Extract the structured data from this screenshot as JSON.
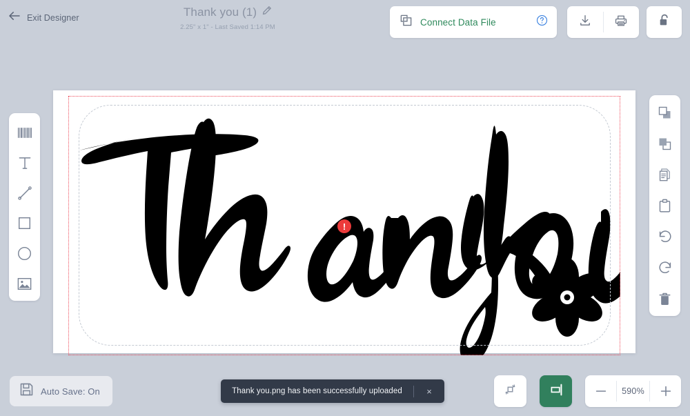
{
  "header": {
    "exit_label": "Exit Designer",
    "exit_icon": "arrow-left-icon",
    "doc_title": "Thank you (1)",
    "doc_title_edit_icon": "pencil-icon",
    "doc_subtitle": "2.25\" x 1\" - Last Saved 1:14 PM",
    "connect_data_file": {
      "label": "Connect Data File",
      "icon": "connect-link-icon",
      "help_icon": "question-circle-icon",
      "text_color": "#2f8a5c",
      "help_color": "#3b82e0"
    },
    "io_buttons": [
      {
        "name": "download-button",
        "icon": "download-icon"
      },
      {
        "name": "print-button",
        "icon": "printer-icon"
      }
    ],
    "lock_button": {
      "name": "lock-button",
      "icon": "unlock-icon",
      "state": "unlocked"
    }
  },
  "left_toolbar": {
    "items": [
      {
        "name": "tool-barcode",
        "icon": "barcode-icon"
      },
      {
        "name": "tool-text",
        "icon": "text-t-icon"
      },
      {
        "name": "tool-line",
        "icon": "line-icon"
      },
      {
        "name": "tool-rectangle",
        "icon": "rectangle-icon"
      },
      {
        "name": "tool-ellipse",
        "icon": "circle-icon"
      },
      {
        "name": "tool-image",
        "icon": "image-icon"
      }
    ]
  },
  "right_toolbar": {
    "items": [
      {
        "name": "bring-to-front-button",
        "icon": "bring-to-front-icon"
      },
      {
        "name": "send-to-back-button",
        "icon": "send-to-back-icon"
      },
      {
        "name": "copy-button",
        "icon": "copy-icon"
      },
      {
        "name": "paste-button",
        "icon": "clipboard-icon"
      },
      {
        "name": "undo-button",
        "icon": "undo-icon"
      },
      {
        "name": "redo-button",
        "icon": "redo-icon"
      },
      {
        "name": "delete-button",
        "icon": "trash-icon"
      }
    ]
  },
  "canvas": {
    "artwork_text": "Thank you",
    "artwork_ornament": "six-petal-flower",
    "artwork_color": "#000000",
    "selection_border_color": "#ef4a5a",
    "safe_area_border_color": "#c3c9d2",
    "warning_badge": {
      "name": "image-resolution-warning-badge",
      "glyph": "!",
      "color": "#ec3b3b"
    }
  },
  "footer": {
    "autosave_label": "Auto Save: On",
    "autosave_icon": "save-floppy-icon",
    "toast": {
      "message": "Thank you.png has been successfully uploaded",
      "close_glyph": "×",
      "background": "#323a48"
    },
    "transform_button": {
      "name": "transform-button",
      "icon": "rotate-transform-icon"
    },
    "align_button": {
      "name": "align-button",
      "icon": "align-right-icon",
      "color": "#31805d"
    },
    "zoom": {
      "minus_glyph": "−",
      "value": "590%",
      "plus_glyph": "+"
    }
  }
}
